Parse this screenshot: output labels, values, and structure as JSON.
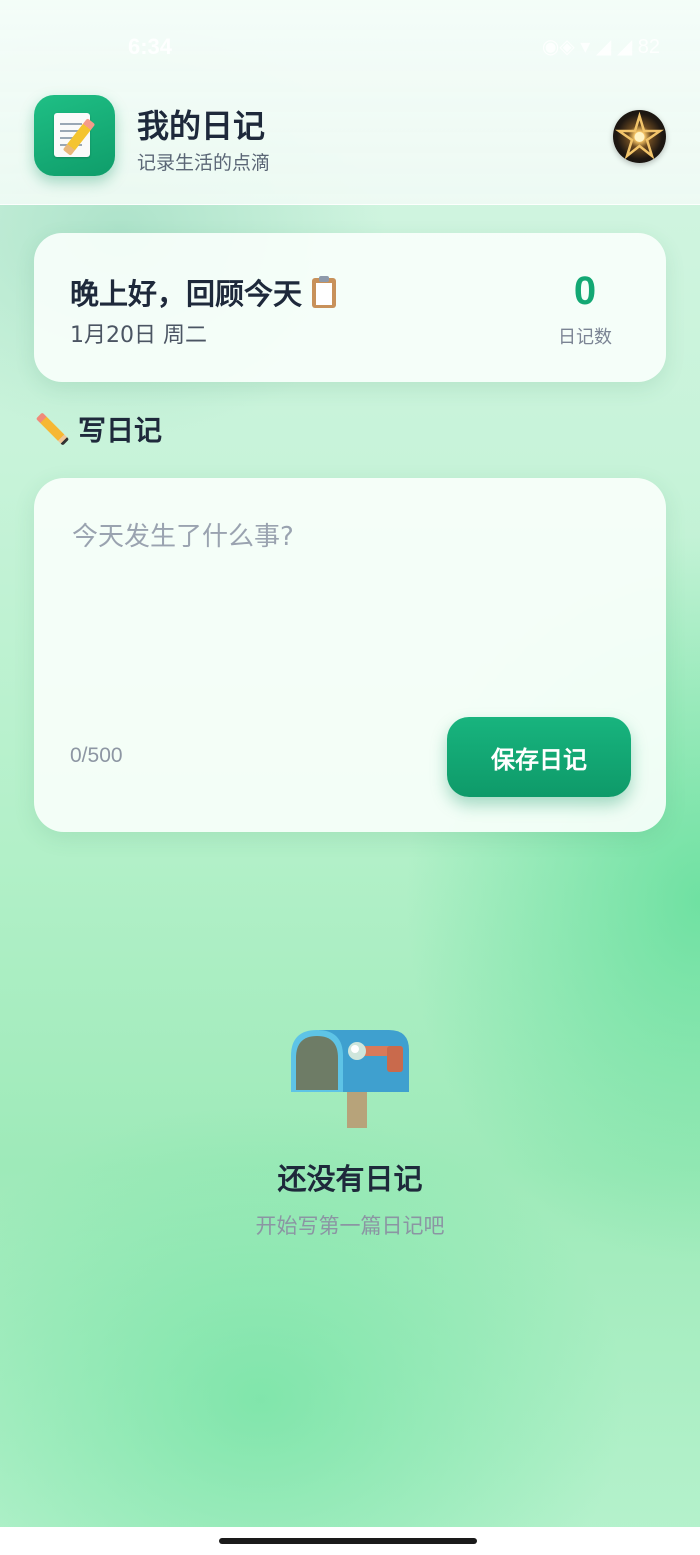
{
  "status_bar": {
    "time": "6:34",
    "right_text": "◉◈ ▾ ◢ ◢ 82"
  },
  "header": {
    "title": "我的日记",
    "subtitle": "记录生活的点滴",
    "app_icon": "notepad-pencil-icon",
    "avatar_icon": "gold-star-avatar"
  },
  "greeting": {
    "text": "晚上好，回顾今天",
    "icon": "clipboard-icon",
    "date": "1月20日 周二",
    "count_value": "0",
    "count_label": "日记数"
  },
  "editor": {
    "section_title": "写日记",
    "section_icon": "pencil-icon",
    "placeholder": "今天发生了什么事?",
    "value": "",
    "char_count": "0/500",
    "save_label": "保存日记"
  },
  "empty_state": {
    "icon": "mailbox-icon",
    "title": "还没有日记",
    "subtitle": "开始写第一篇日记吧"
  },
  "colors": {
    "accent": "#13a874",
    "button": "#10a06d",
    "title": "#1e293b"
  }
}
